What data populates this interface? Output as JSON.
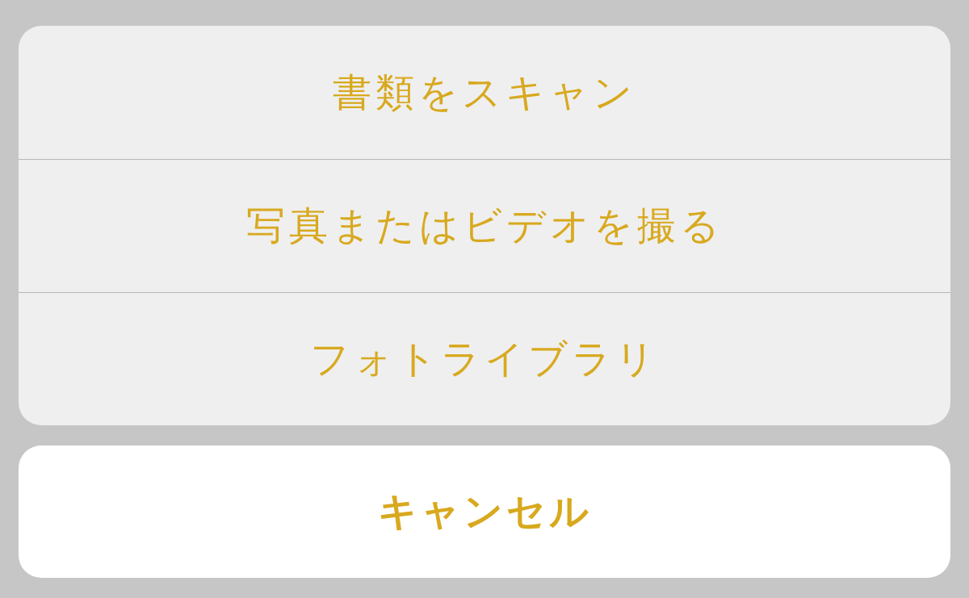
{
  "action_sheet": {
    "options": [
      {
        "label": "書類をスキャン"
      },
      {
        "label": "写真またはビデオを撮る"
      },
      {
        "label": "フォトライブラリ"
      }
    ]
  },
  "cancel_button": {
    "label": "キャンセル"
  }
}
